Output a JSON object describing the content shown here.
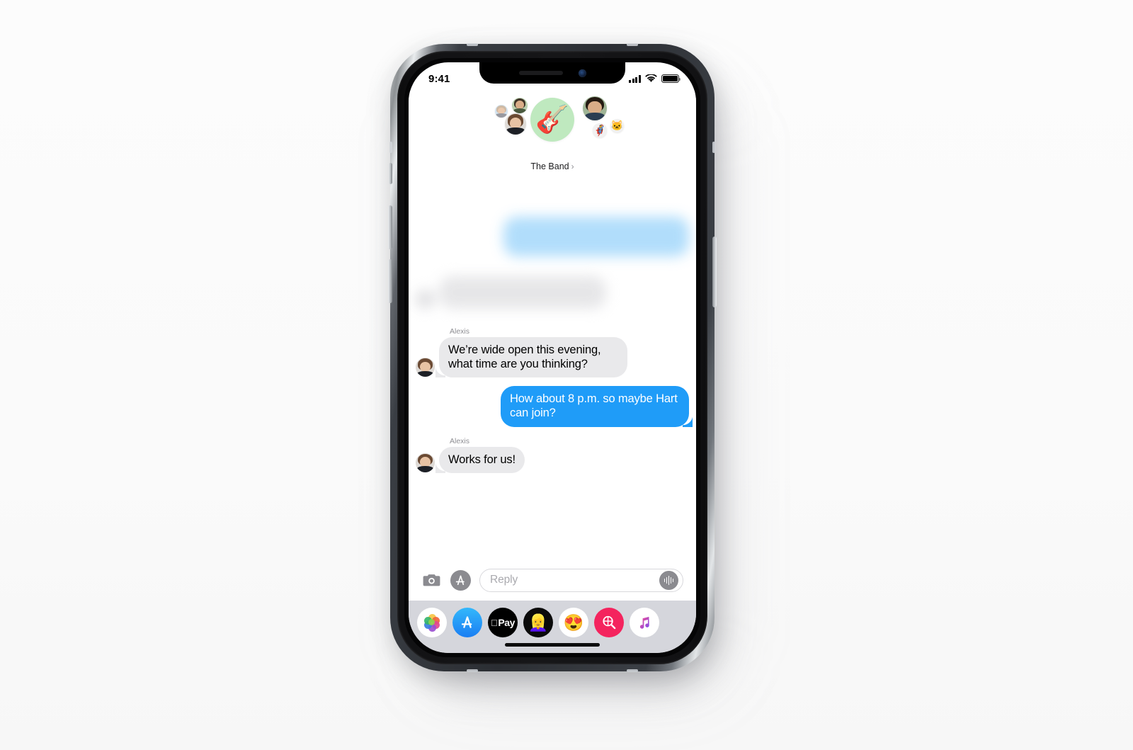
{
  "device": {
    "model_label": "iPhone",
    "frame": "notch"
  },
  "status_bar": {
    "time": "9:41",
    "cellular_icon": "signal-bars-icon",
    "wifi_icon": "wifi-icon",
    "battery_icon": "battery-full-icon"
  },
  "group_header": {
    "title": "The Band",
    "chevron": "›",
    "main_avatar_emoji": "🎸",
    "main_avatar_bg": "#bfe9bf",
    "mini_avatars": [
      {
        "name": "avatar-member-1",
        "kind": "photo"
      },
      {
        "name": "avatar-member-2",
        "kind": "photo"
      },
      {
        "name": "avatar-member-3",
        "kind": "photo"
      },
      {
        "name": "avatar-member-4",
        "kind": "photo"
      },
      {
        "name": "avatar-member-5",
        "kind": "emoji",
        "emoji": "🦸"
      },
      {
        "name": "avatar-member-6",
        "kind": "emoji",
        "emoji": "🐱"
      }
    ]
  },
  "conversation": {
    "messages": [
      {
        "id": "m1",
        "side": "out",
        "state": "blurred",
        "text": "",
        "sender": ""
      },
      {
        "id": "m2",
        "side": "in",
        "state": "blurred",
        "text": "",
        "sender": ""
      },
      {
        "id": "m3",
        "side": "in",
        "state": "visible",
        "sender": "Alexis",
        "text": "We’re wide open this evening, what time are you thinking?"
      },
      {
        "id": "m4",
        "side": "out",
        "state": "visible",
        "sender": "",
        "text": "How about 8 p.m. so maybe Hart can join?"
      },
      {
        "id": "m5",
        "side": "in",
        "state": "visible",
        "sender": "Alexis",
        "text": "Works for us!"
      }
    ],
    "bubble_color_incoming": "#e9e9eb",
    "bubble_color_outgoing": "#1f9cf8",
    "text_color_incoming": "#000000",
    "text_color_outgoing": "#ffffff"
  },
  "input_bar": {
    "camera_icon": "camera-icon",
    "apps_icon": "app-store-icon",
    "placeholder": "Reply",
    "value": "",
    "audio_icon": "audio-waveform-icon"
  },
  "app_drawer": {
    "apps": [
      {
        "name": "app-photos",
        "label": "Photos",
        "glyph": ""
      },
      {
        "name": "app-app-store",
        "label": "App Store",
        "glyph": "🅰"
      },
      {
        "name": "app-apple-pay",
        "label": "Apple Pay",
        "glyph": "Pay"
      },
      {
        "name": "app-memoji",
        "label": "Memoji",
        "glyph": "👱‍♀️"
      },
      {
        "name": "app-animoji",
        "label": "Animoji",
        "glyph": "😍"
      },
      {
        "name": "app-images",
        "label": "#images",
        "glyph": ""
      },
      {
        "name": "app-music",
        "label": "Music",
        "glyph": "🎵"
      }
    ]
  },
  "home_indicator": {
    "label": "home-indicator"
  }
}
